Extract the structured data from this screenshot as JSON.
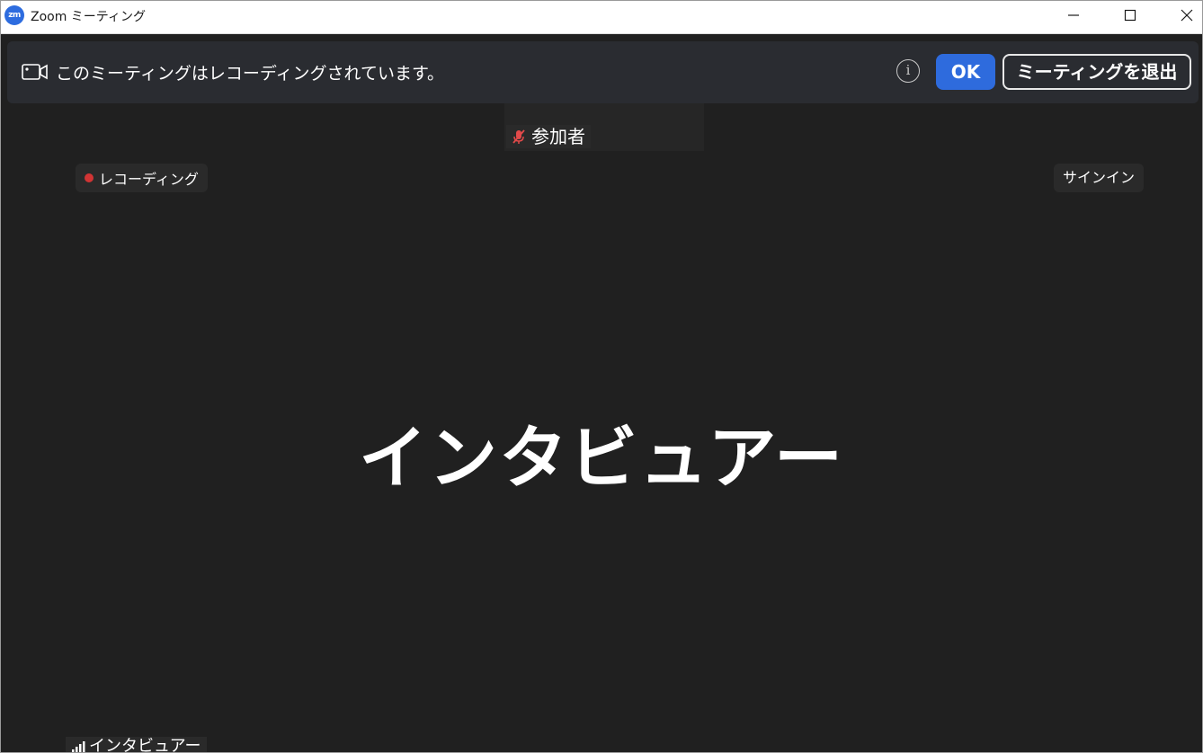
{
  "window": {
    "title": "Zoom ミーティング",
    "logo_text": "zm"
  },
  "notification": {
    "message": "このミーティングはレコーディングされています。",
    "ok_label": "OK",
    "leave_label": "ミーティングを退出",
    "info_glyph": "i"
  },
  "participants_label": "参加者",
  "recording_badge": "レコーディング",
  "signin_label": "サインイン",
  "active_speaker": {
    "name": "インタビュアー"
  },
  "self_tile": {
    "name": "インタビュアー"
  },
  "colors": {
    "meeting_bg": "#202020",
    "accent_blue": "#2e6bdd",
    "recording_red": "#d13434"
  },
  "icons": [
    "zoom-logo-icon",
    "minimize-icon",
    "maximize-icon",
    "close-icon",
    "camera-record-icon",
    "info-icon",
    "muted-mic-icon",
    "recording-dot-icon",
    "signal-bars-icon"
  ]
}
